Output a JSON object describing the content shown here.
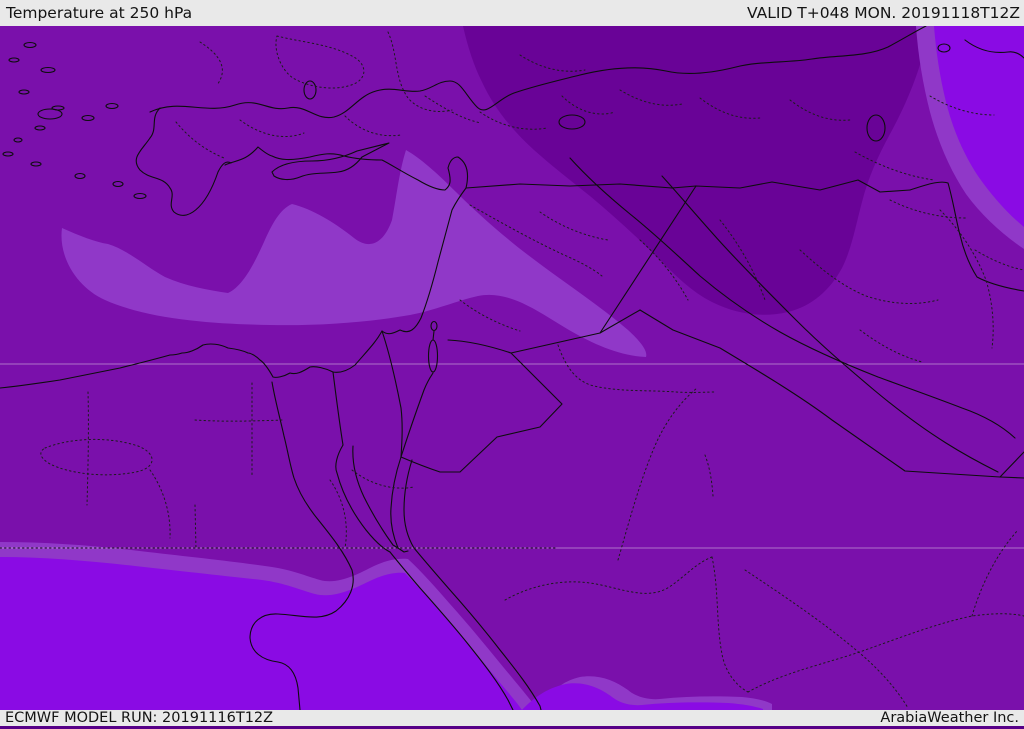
{
  "header": {
    "title": "Temperature at 250 hPa",
    "valid_label": "VALID T+048 MON. 20191118T12Z"
  },
  "footer": {
    "model_run": "ECMWF MODEL RUN: 20191116T12Z",
    "credit": "ArabiaWeather Inc."
  },
  "map": {
    "parameter": "Temperature",
    "level": "250 hPa",
    "model": "ECMWF",
    "region": "Middle East / Eastern Mediterranean",
    "palette": {
      "band_coldest": "#690397",
      "band_cold": "#7a10ab",
      "band_mild": "#9038c8",
      "band_warm": "#8a0be4",
      "outline": "#0d0d0d",
      "admin_dotted": "#1c1c1c",
      "graticule": "#d9c2e2",
      "header_bar": "#e9e9e9",
      "footer_bar": "#e9e9e9",
      "bottom_strip": "#560087",
      "text": "#141414"
    }
  }
}
